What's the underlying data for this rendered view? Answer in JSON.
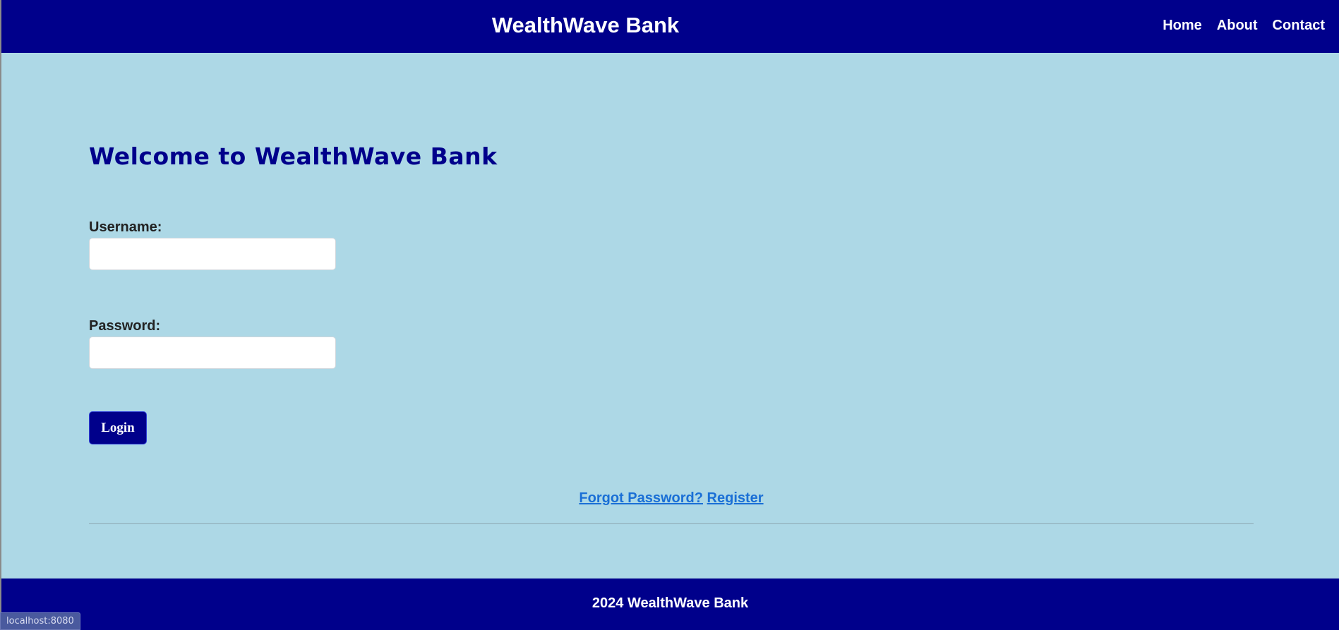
{
  "header": {
    "brand": "WealthWave Bank",
    "nav": [
      "Home",
      "About",
      "Contact"
    ]
  },
  "main": {
    "title": "Welcome to WealthWave Bank",
    "username_label": "Username:",
    "username_value": "",
    "password_label": "Password:",
    "password_value": "",
    "login_label": "Login",
    "forgot_password": "Forgot Password?",
    "register": "Register"
  },
  "footer": {
    "text": "2024 WealthWave Bank"
  },
  "status_bar": {
    "url": "localhost:8080"
  },
  "colors": {
    "primary": "#00008b",
    "background": "#add8e6",
    "link": "#1a6fd6"
  }
}
